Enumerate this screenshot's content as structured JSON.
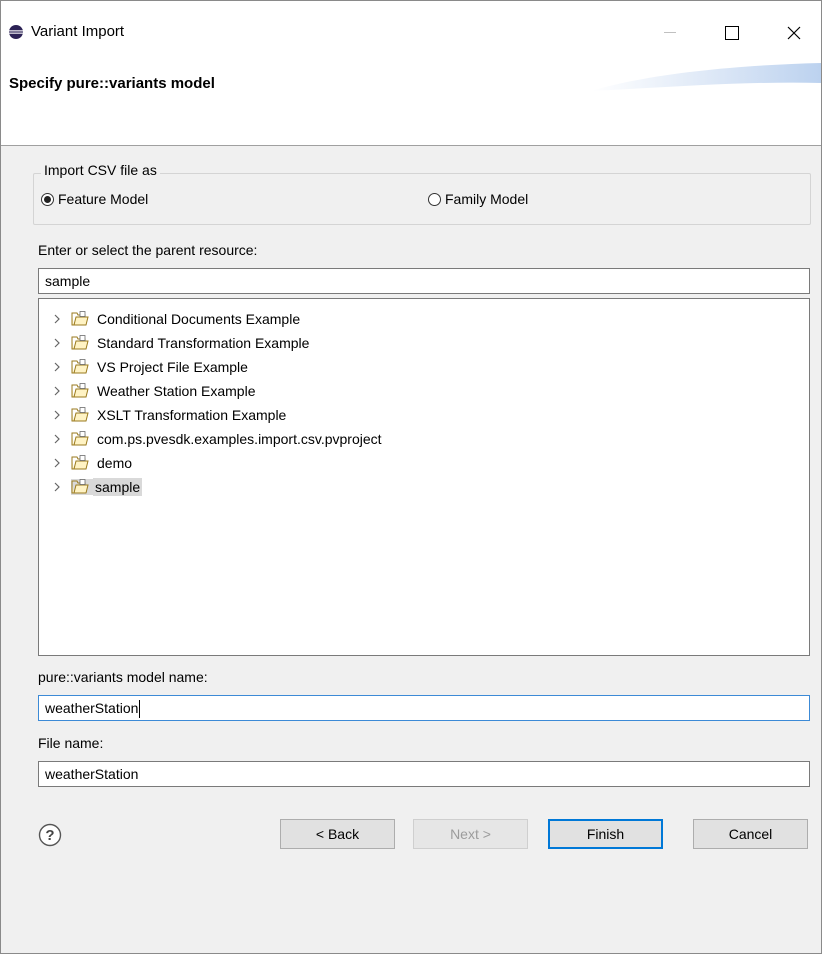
{
  "window": {
    "title": "Variant Import",
    "minimize_glyph": "—",
    "maximize_glyph": "☐",
    "close_glyph": "✕"
  },
  "banner": {
    "title": "Specify pure::variants model"
  },
  "import_group": {
    "legend": "Import CSV file as",
    "options": [
      {
        "label": "Feature Model",
        "selected": true
      },
      {
        "label": "Family Model",
        "selected": false
      }
    ]
  },
  "parent_resource": {
    "label": "Enter or select the parent resource:",
    "value": "sample"
  },
  "tree": {
    "items": [
      {
        "label": "Conditional Documents Example",
        "selected": false
      },
      {
        "label": "Standard Transformation Example",
        "selected": false
      },
      {
        "label": "VS Project File Example",
        "selected": false
      },
      {
        "label": "Weather Station Example",
        "selected": false
      },
      {
        "label": "XSLT Transformation Example",
        "selected": false
      },
      {
        "label": "com.ps.pvesdk.examples.import.csv.pvproject",
        "selected": false
      },
      {
        "label": "demo",
        "selected": false
      },
      {
        "label": "sample",
        "selected": true
      }
    ]
  },
  "model_name": {
    "label": "pure::variants model name:",
    "value": "weatherStation"
  },
  "file_name": {
    "label": "File name:",
    "value": "weatherStation"
  },
  "buttons": {
    "back": "< Back",
    "next": "Next >",
    "finish": "Finish",
    "cancel": "Cancel"
  },
  "icons": {
    "app": "eclipse-icon",
    "help": "help-icon",
    "folder": "project-folder-icon",
    "expand": "chevron-right-icon"
  },
  "colors": {
    "accent": "#0078d7",
    "focus_border": "#3c8ad6",
    "selection": "#d9d9d9",
    "dialog_bg": "#f0f0f0"
  }
}
